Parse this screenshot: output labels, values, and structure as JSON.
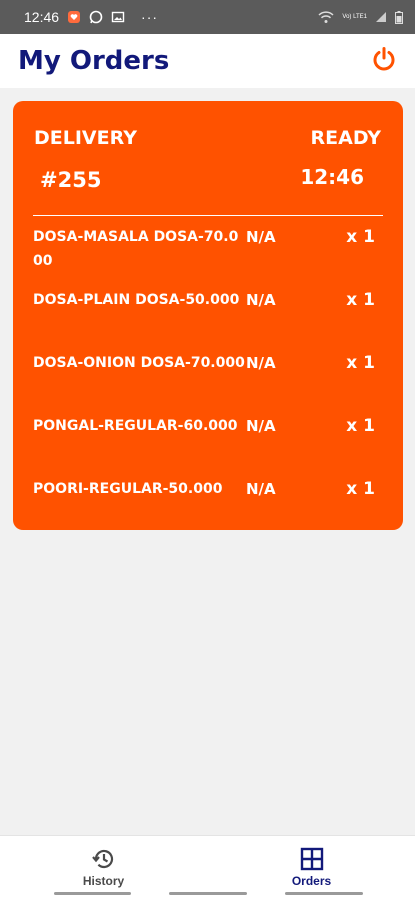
{
  "colors": {
    "accent": "#ff5200",
    "brand_navy": "#12197a",
    "status_bar": "#5b5b5b",
    "background": "#f1f1f1"
  },
  "status_bar": {
    "time": "12:46",
    "overflow": "···",
    "volte_label": "Vo) LTE1",
    "icons": [
      "heart-app-icon",
      "whatsapp-icon",
      "image-icon",
      "wifi-icon",
      "volte-icon",
      "signal-icon",
      "battery-icon"
    ]
  },
  "header": {
    "title": "My Orders",
    "power_icon": "power-icon"
  },
  "order": {
    "type": "DELIVERY",
    "status": "READY",
    "number": "#255",
    "time": "12:46",
    "items": [
      {
        "name": "DOSA-MASALA DOSA-70.000",
        "extra": "N/A",
        "qty": "x 1"
      },
      {
        "name": "DOSA-PLAIN DOSA-50.000",
        "extra": "N/A",
        "qty": "x 1"
      },
      {
        "name": "DOSA-ONION DOSA-70.000",
        "extra": "N/A",
        "qty": "x 1"
      },
      {
        "name": "PONGAL-REGULAR-60.000",
        "extra": "N/A",
        "qty": "x 1"
      },
      {
        "name": "POORI-REGULAR-50.000",
        "extra": "N/A",
        "qty": "x 1"
      }
    ]
  },
  "bottom_nav": {
    "tabs": [
      {
        "label": "History",
        "icon": "history-icon",
        "active": false
      },
      {
        "label": "Orders",
        "icon": "grid-icon",
        "active": true
      }
    ]
  }
}
